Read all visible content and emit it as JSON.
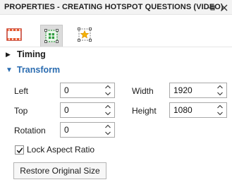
{
  "panel": {
    "title": "PROPERTIES - CREATING HOTSPOT QUESTIONS (VIDEO)"
  },
  "tabs": [
    {
      "icon": "video-film-icon",
      "active": false
    },
    {
      "icon": "hotspot-properties-icon",
      "active": true
    },
    {
      "icon": "star-selection-icon",
      "active": false
    }
  ],
  "sections": {
    "timing": {
      "label": "Timing",
      "expanded": false
    },
    "transform": {
      "label": "Transform",
      "expanded": true
    }
  },
  "transform": {
    "left": {
      "label": "Left",
      "value": "0"
    },
    "top": {
      "label": "Top",
      "value": "0"
    },
    "rotation": {
      "label": "Rotation",
      "value": "0"
    },
    "width": {
      "label": "Width",
      "value": "1920"
    },
    "height": {
      "label": "Height",
      "value": "1080"
    },
    "lock_aspect": {
      "label": "Lock Aspect Ratio",
      "checked": true
    },
    "restore_button": "Restore Original Size"
  },
  "colors": {
    "section_accent": "#2b6cb0",
    "film_icon": "#c0392b",
    "hotspot_icon": "#2e9e3e",
    "star_icon": "#e8a317"
  }
}
